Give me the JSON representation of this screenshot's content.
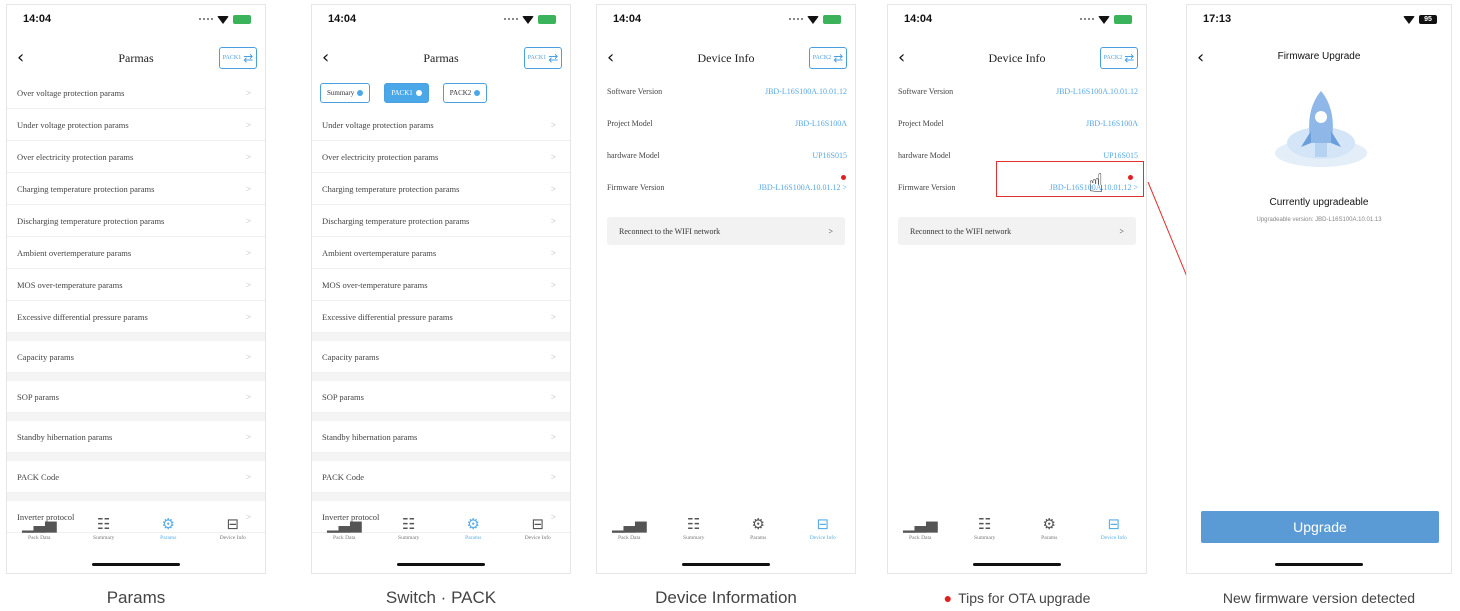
{
  "status": {
    "time_a": "14:04",
    "time_b": "17:13",
    "battery_b": "95"
  },
  "nav": {
    "params_title": "Parmas",
    "device_title": "Device Info",
    "firmware_title": "Firmware Upgrade",
    "pack1": "PACK1",
    "pack2": "PACK2"
  },
  "params_rows": [
    "Over voltage protection params",
    "Under voltage protection params",
    "Over electricity protection params",
    "Charging temperature protection params",
    "Discharging temperature protection params",
    "Ambient overtemperature params",
    "MOS over-temperature params",
    "Excessive differential pressure params",
    "Capacity params",
    "SOP params",
    "Standby hibernation params",
    "PACK Code",
    "Inverter protocol"
  ],
  "segments": {
    "summary": "Summary",
    "pack1": "PACK1",
    "pack2": "PACK2"
  },
  "device_info": {
    "software_label": "Software Version",
    "software_value": "JBD-L16S100A.10.01.12",
    "project_label": "Project Model",
    "project_value": "JBD-L16S100A",
    "hardware_label": "hardware Model",
    "hardware_value": "UP16S015",
    "firmware_label": "Firmware Version",
    "firmware_value": "JBD-L16S100A.10.01.12",
    "reconnect": "Reconnect to the WIFI network"
  },
  "tabs": {
    "pack_data": "Pack Data",
    "summary": "Summary",
    "params": "Params",
    "device_info": "Device Info"
  },
  "firmware": {
    "status": "Currently upgradeable",
    "version": "Upgradeable version: JBD-L16S100A.10.01.13",
    "button": "Upgrade"
  },
  "captions": {
    "c1": "Params",
    "c2": "Switch · PACK",
    "c3": "Device Information",
    "c4": "Tips for OTA upgrade",
    "c5": "New firmware version detected"
  },
  "colors": {
    "accent": "#4aa8e8",
    "alert": "#e02020",
    "button": "#5b9bd5"
  }
}
